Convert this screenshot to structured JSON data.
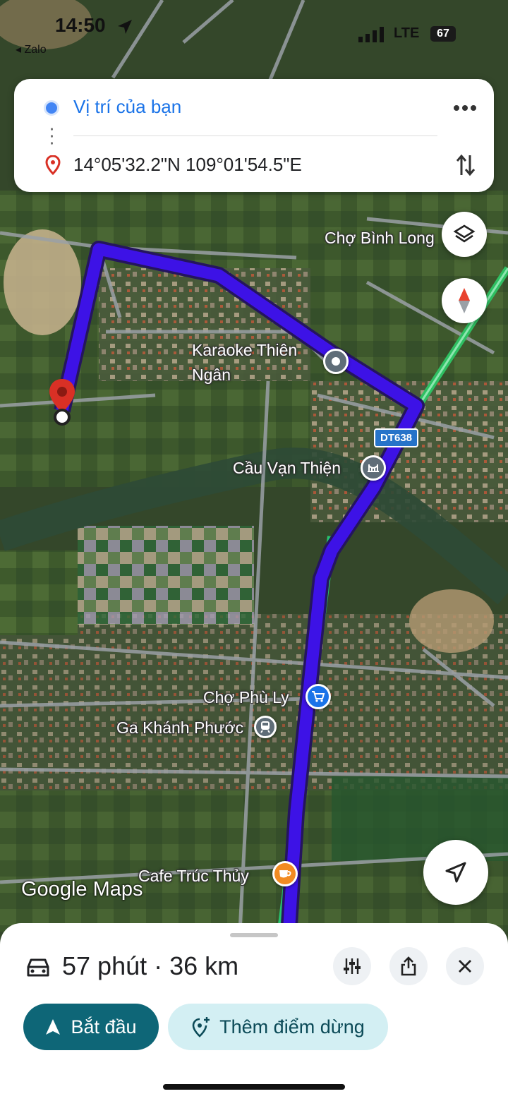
{
  "status_bar": {
    "time": "14:50",
    "back_app": "◂ Zalo",
    "network": "LTE",
    "battery": "67"
  },
  "directions": {
    "origin": "Vị trí của bạn",
    "destination": "14°05'32.2\"N 109°01'54.5\"E"
  },
  "map": {
    "labels": {
      "cho_binh_long": "Chợ Bình Long",
      "karaoke_line1": "Karaoke Thiên",
      "karaoke_line2": "Ngân",
      "road_shield": "DT638",
      "cau_van_thien": "Cầu Vạn Thiện",
      "cho_phu_ly": "Chợ Phù Ly",
      "ga_khanh_phuoc": "Ga Khánh Phước",
      "cafe_truc_thuy": "Cafe Trúc Thủy"
    },
    "watermark": "Google Maps",
    "route_color": "#3d12e6",
    "highway_color": "#27c46e"
  },
  "trip": {
    "summary": "57 phút · 36 km"
  },
  "actions": {
    "start_label": "Bắt đầu",
    "add_stop_label": "Thêm điểm dừng"
  },
  "colors": {
    "primary": "#0e6677",
    "secondary_bg": "#d3eff3",
    "link_blue": "#1a73e8",
    "pin_red": "#d93025"
  }
}
